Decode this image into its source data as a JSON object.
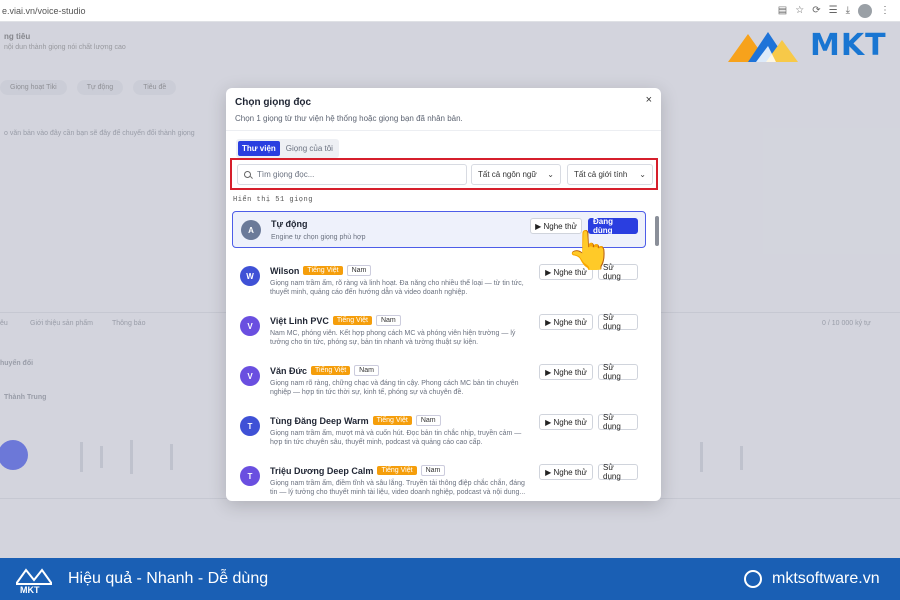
{
  "browser": {
    "url": "e.viai.vn/voice-studio"
  },
  "background": {
    "title": "ng tiêu",
    "subtitle": "nội dun thành giọng nói chất lượng cao",
    "tabs": [
      "Giọng hoạt Tiki",
      "Tự động",
      "Tiêu đề"
    ],
    "hint": "o văn bản vào đây cần bạn sẽ đây để chuyển đổi thành giọng",
    "mid_tabs": [
      "êu",
      "Giới thiệu sản phẩm",
      "Thông báo"
    ],
    "section": "huyển đổi",
    "speaker": "Thành Trung",
    "right_count": "0 / 10 000 ký tự"
  },
  "brand": {
    "name": "MKT"
  },
  "modal": {
    "title": "Chọn giọng đọc",
    "description": "Chọn 1 giọng từ thư viện hệ thống hoặc giọng bạn đã nhân bản.",
    "close": "×",
    "tabs": [
      "Thư viện",
      "Giọng của tôi"
    ],
    "search_placeholder": "Tìm giọng đọc...",
    "language_filter": "Tất cả ngôn ngữ",
    "gender_filter": "Tất cả giới tính",
    "count_text": "Hiển thị 51 giọng",
    "voices": [
      {
        "initial": "A",
        "name": "Tự động",
        "lang": "",
        "gender": "",
        "desc": "Engine tự chọn giọng phù hợp",
        "preview_label": "▶ Nghe thử",
        "action_label": "Đang dùng",
        "color": "#6b7a99"
      },
      {
        "initial": "W",
        "name": "Wilson",
        "lang": "Tiếng Việt",
        "gender": "Nam",
        "desc": "Giọng nam trầm ấm, rõ ràng và linh hoạt. Đa năng cho nhiều thể loại — từ tin tức, thuyết minh, quảng cáo đến hướng dẫn và video doanh nghiệp.",
        "preview_label": "▶ Nghe thử",
        "action_label": "Sử dụng",
        "color": "#3f51d6"
      },
      {
        "initial": "V",
        "name": "Việt Linh PVC",
        "lang": "Tiếng Việt",
        "gender": "Nam",
        "desc": "Nam MC, phóng viên. Kết hợp phong cách MC và phóng viên hiện trường — lý tưởng cho tin tức, phóng sự, bản tin nhanh và tường thuật sự kiện.",
        "preview_label": "▶ Nghe thử",
        "action_label": "Sử dụng",
        "color": "#6a4fe0"
      },
      {
        "initial": "V",
        "name": "Văn Đức",
        "lang": "Tiếng Việt",
        "gender": "Nam",
        "desc": "Giọng nam rõ ràng, chững chạc và đáng tin cậy. Phong cách MC bản tin chuyên nghiệp — hợp tin tức thời sự, kinh tế, phóng sự và chuyên đề.",
        "preview_label": "▶ Nghe thử",
        "action_label": "Sử dụng",
        "color": "#6a4fe0"
      },
      {
        "initial": "T",
        "name": "Tùng Đăng Deep Warm",
        "lang": "Tiếng Việt",
        "gender": "Nam",
        "desc": "Giọng nam trầm ấm, mượt mà và cuốn hút. Đọc bản tin chắc nhịp, truyền cảm — hợp tin tức chuyên sâu, thuyết minh, podcast và quảng cáo cao cấp.",
        "preview_label": "▶ Nghe thử",
        "action_label": "Sử dụng",
        "color": "#3f51d6"
      },
      {
        "initial": "T",
        "name": "Triệu Dương Deep Calm",
        "lang": "Tiếng Việt",
        "gender": "Nam",
        "desc": "Giọng nam trầm ấm, điềm tĩnh và sâu lắng. Truyền tải thông điệp chắc chắn, đáng tin — lý tưởng cho thuyết minh tài liệu, video doanh nghiệp, podcast và nội dung...",
        "preview_label": "▶ Nghe thử",
        "action_label": "Sử dụng",
        "color": "#6a4fe0"
      }
    ]
  },
  "footer": {
    "brand": "MKT",
    "tagline": "Hiệu quả - Nhanh - Dễ dùng",
    "website": "mktsoftware.vn"
  },
  "colors": {
    "primary": "#2a3ee0",
    "highlight_border": "#d61f2c",
    "language_badge": "#f59e0b",
    "banner": "#1a5fb4"
  }
}
